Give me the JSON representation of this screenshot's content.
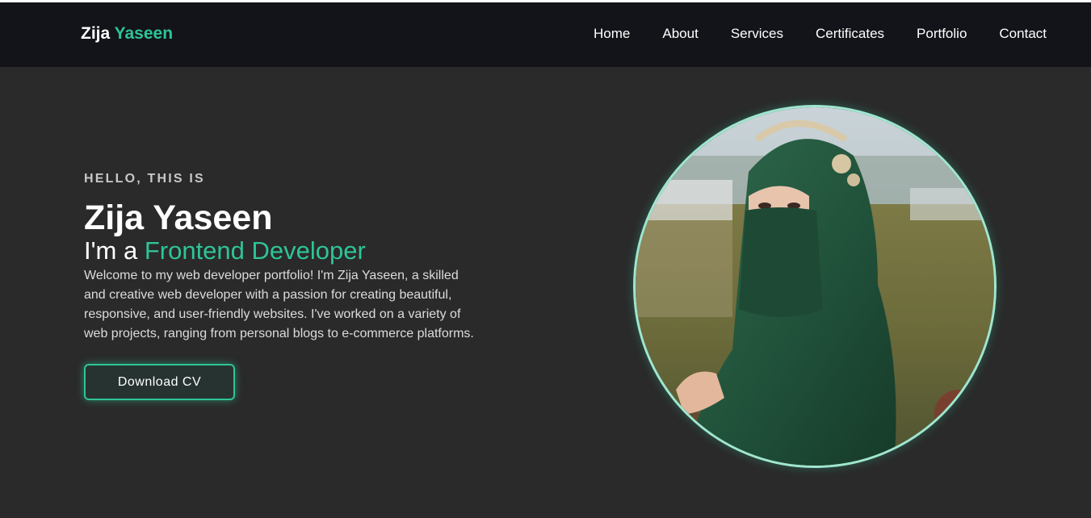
{
  "brand": {
    "first": "Zija",
    "last": "Yaseen"
  },
  "nav": {
    "items": [
      {
        "label": "Home"
      },
      {
        "label": "About"
      },
      {
        "label": "Services"
      },
      {
        "label": "Certificates"
      },
      {
        "label": "Portfolio"
      },
      {
        "label": "Contact"
      }
    ]
  },
  "hero": {
    "greeting": "HELLO, THIS IS",
    "name": "Zija Yaseen",
    "role_prefix": "I'm a ",
    "role": "Frontend Developer",
    "description": "Welcome to my web developer portfolio! I'm Zija Yaseen, a skilled and creative web developer with a passion for creating beautiful, responsive, and user-friendly websites. I've worked on a variety of web projects, ranging from personal blogs to e-commerce platforms.",
    "cv_button": "Download CV"
  },
  "colors": {
    "accent": "#2ec497",
    "navbar_bg": "#131419",
    "page_bg": "#2a2a2a",
    "photo_ring": "#9fe6cf"
  },
  "icons": {
    "profile_photo": "profile-photo-woman-green-hijab"
  }
}
